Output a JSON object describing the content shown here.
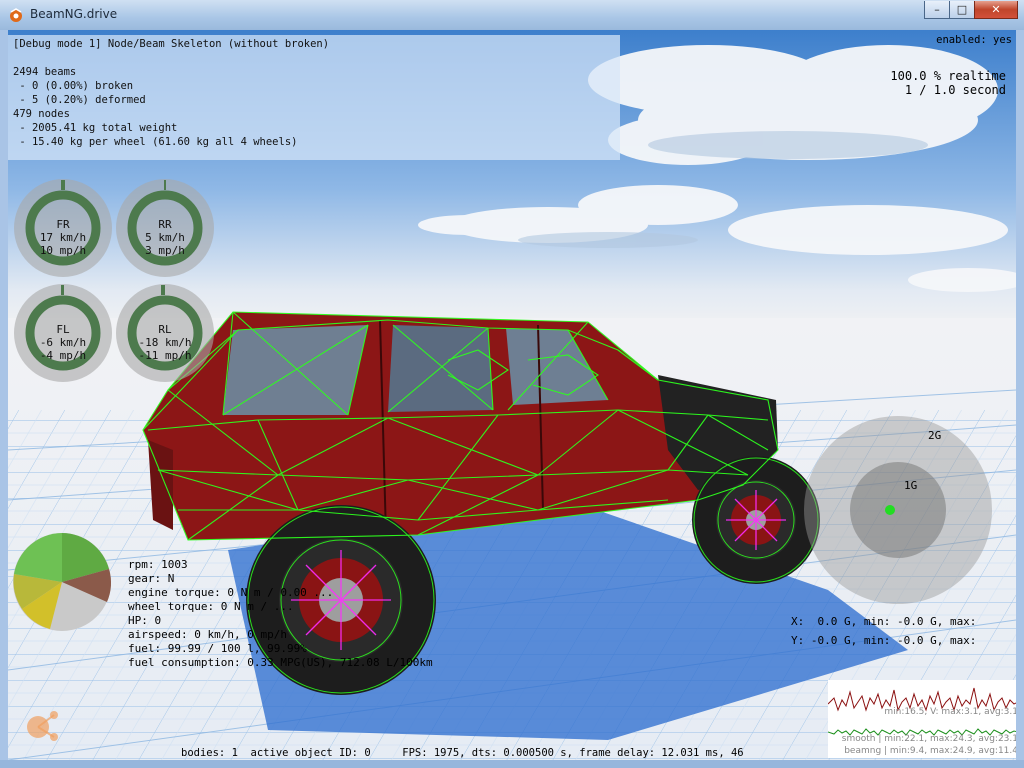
{
  "window": {
    "title": "BeamNG.drive",
    "minimize_glyph": "–",
    "maximize_glyph": "□",
    "close_glyph": "✕",
    "icon": "beamng-logo-icon"
  },
  "debug": {
    "mode_line": "[Debug mode 1] Node/Beam Skeleton (without broken)",
    "lines": [
      "2494 beams",
      " - 0 (0.00%) broken",
      " - 5 (0.20%) deformed",
      "479 nodes",
      " - 2005.41 kg total weight",
      " - 15.40 kg per wheel (61.60 kg all 4 wheels)"
    ],
    "enabled": "enabled: yes",
    "realtime": "100.0 % realtime",
    "second": "1 / 1.0 second"
  },
  "wheels": [
    {
      "id": "FR",
      "kmh": "17 km/h",
      "mph": "10 mp/h"
    },
    {
      "id": "RR",
      "kmh": "5 km/h",
      "mph": "3 mp/h"
    },
    {
      "id": "FL",
      "kmh": "-6 km/h",
      "mph": "-4 mp/h"
    },
    {
      "id": "RL",
      "kmh": "-18 km/h",
      "mph": "-11 mp/h"
    }
  ],
  "gforce": {
    "ring_outer": "2G",
    "ring_inner": "1G",
    "x_line": "X:  0.0 G, min: -0.0 G, max:",
    "y_line": "Y: -0.0 G, min: -0.0 G, max:"
  },
  "vehicle": {
    "rpm": "rpm: 1003",
    "gear": "gear: N",
    "engine_torque": "engine torque: 0 N m / 0.00 ...",
    "wheel_torque": "wheel torque: 0 N m / ...",
    "hp": "HP: 0",
    "airspeed": "airspeed: 0 km/h, 0 mp/h",
    "fuel": "fuel: 99.99 / 100 l, 99.99%",
    "fuel_consumption": "fuel consumption: 0.33 MPG(US), 712.08 L/100km"
  },
  "graph": {
    "smooth": "smooth | min:22.1, max:24.3, avg:23.1",
    "beamng": "beamng | min:9.4, max:24.9, avg:11.4",
    "top_hint": "min:16.5, V: max:3.1, avg:3.1"
  },
  "status": {
    "text": "bodies: 1  active object ID: 0     FPS: 1975, dts: 0.000500 s, frame delay: 12.031 ms, 46"
  },
  "colors": {
    "sky_top": "#4d8ed6",
    "ground": "#ececf0",
    "body_red": "#8f1a1a",
    "beam_green": "#2dff1e",
    "node_magenta": "#ff2cff",
    "gauge_green": "#4d7a4d"
  }
}
